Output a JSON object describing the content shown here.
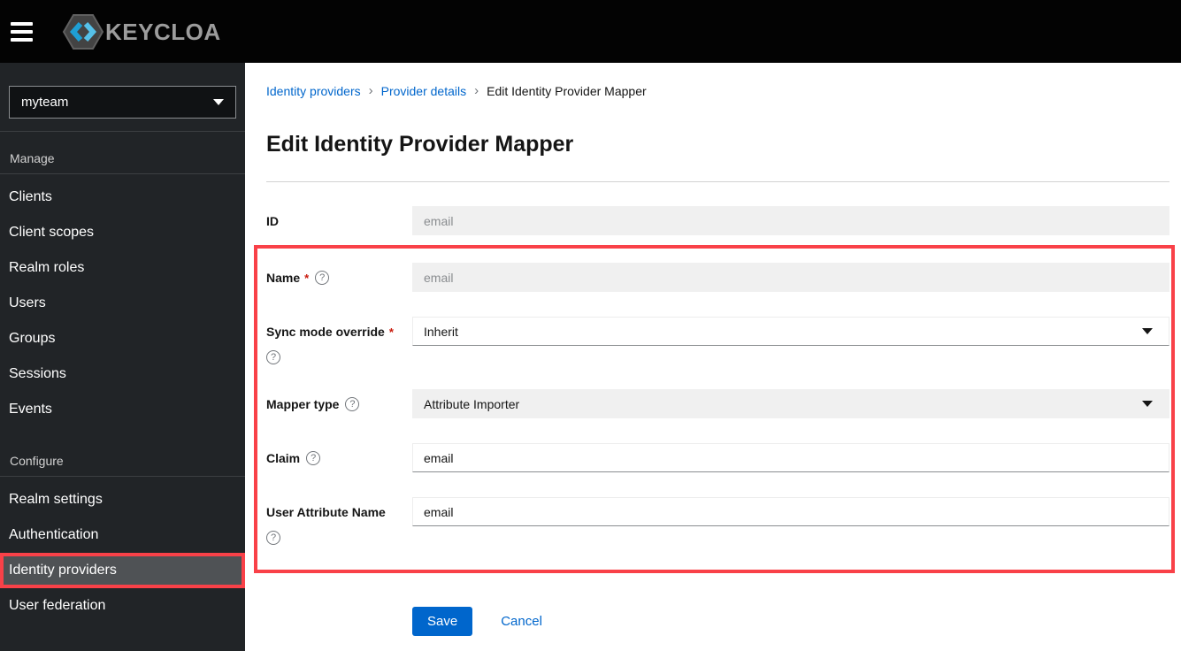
{
  "topbar": {
    "brand_text": "KEYCLOAK"
  },
  "sidebar": {
    "realm_selector": {
      "value": "myteam"
    },
    "sections": [
      {
        "title": "Manage",
        "items": [
          "Clients",
          "Client scopes",
          "Realm roles",
          "Users",
          "Groups",
          "Sessions",
          "Events"
        ]
      },
      {
        "title": "Configure",
        "items": [
          "Realm settings",
          "Authentication",
          "Identity providers",
          "User federation"
        ],
        "active_item": "Identity providers"
      }
    ]
  },
  "breadcrumb": {
    "separator": "›",
    "items": [
      "Identity providers",
      "Provider details",
      "Edit Identity Provider Mapper"
    ]
  },
  "page": {
    "title": "Edit Identity Provider Mapper"
  },
  "form": {
    "required_marker": "*",
    "help_glyph": "?",
    "fields": [
      {
        "label": "ID",
        "value": "email",
        "type": "text",
        "disabled": true,
        "required": false,
        "help": false
      },
      {
        "label": "Name",
        "value": "email",
        "type": "text",
        "disabled": true,
        "required": true,
        "help": true
      },
      {
        "label": "Sync mode override",
        "value": "Inherit",
        "type": "select",
        "disabled": false,
        "required": true,
        "help": true
      },
      {
        "label": "Mapper type",
        "value": "Attribute Importer",
        "type": "select",
        "disabled": true,
        "required": false,
        "help": true
      },
      {
        "label": "Claim",
        "value": "email",
        "type": "text",
        "disabled": false,
        "required": false,
        "help": true
      },
      {
        "label": "User Attribute Name",
        "value": "email",
        "type": "text",
        "disabled": false,
        "required": false,
        "help": true
      }
    ],
    "actions": {
      "save_label": "Save",
      "cancel_label": "Cancel"
    }
  },
  "colors": {
    "topbar_bg": "#030303",
    "sidebar_bg": "#212427",
    "active_nav_bg": "#4f5255",
    "link_blue": "#0066cc",
    "primary_button_bg": "#0066cc",
    "annotation_red": "#f94148",
    "required_red": "#c9190b",
    "disabled_input_bg": "#f0f0f0"
  }
}
